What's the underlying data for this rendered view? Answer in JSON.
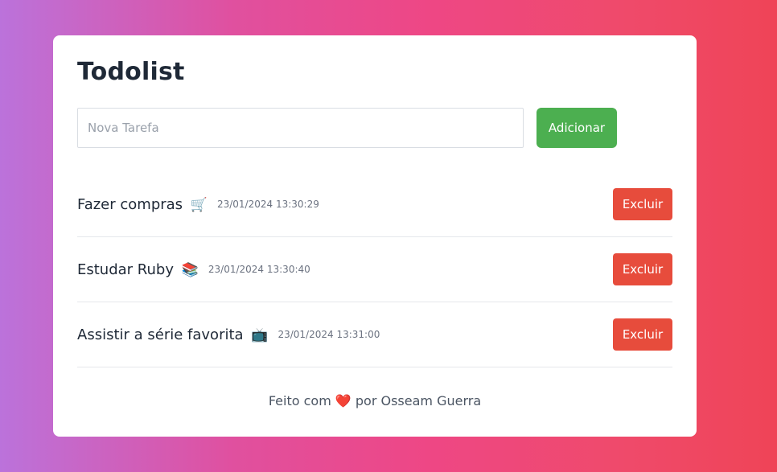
{
  "app": {
    "title": "Todolist"
  },
  "new_task": {
    "placeholder": "Nova Tarefa",
    "value": "",
    "add_label": "Adicionar"
  },
  "tasks": [
    {
      "text": "Fazer compras",
      "emoji": "🛒",
      "emoji_icon": "shopping-cart-icon",
      "timestamp": "23/01/2024 13:30:29",
      "delete_label": "Excluir"
    },
    {
      "text": "Estudar Ruby",
      "emoji": "📚",
      "emoji_icon": "books-icon",
      "timestamp": "23/01/2024 13:30:40",
      "delete_label": "Excluir"
    },
    {
      "text": "Assistir a série favorita",
      "emoji": "📺",
      "emoji_icon": "television-icon",
      "timestamp": "23/01/2024 13:31:00",
      "delete_label": "Excluir"
    }
  ],
  "footer": {
    "prefix": "Feito com",
    "heart": "❤️",
    "suffix": "por Osseam Guerra"
  },
  "colors": {
    "add_button": "#4caf50",
    "delete_button": "#e74c3c",
    "title": "#1f2937"
  }
}
